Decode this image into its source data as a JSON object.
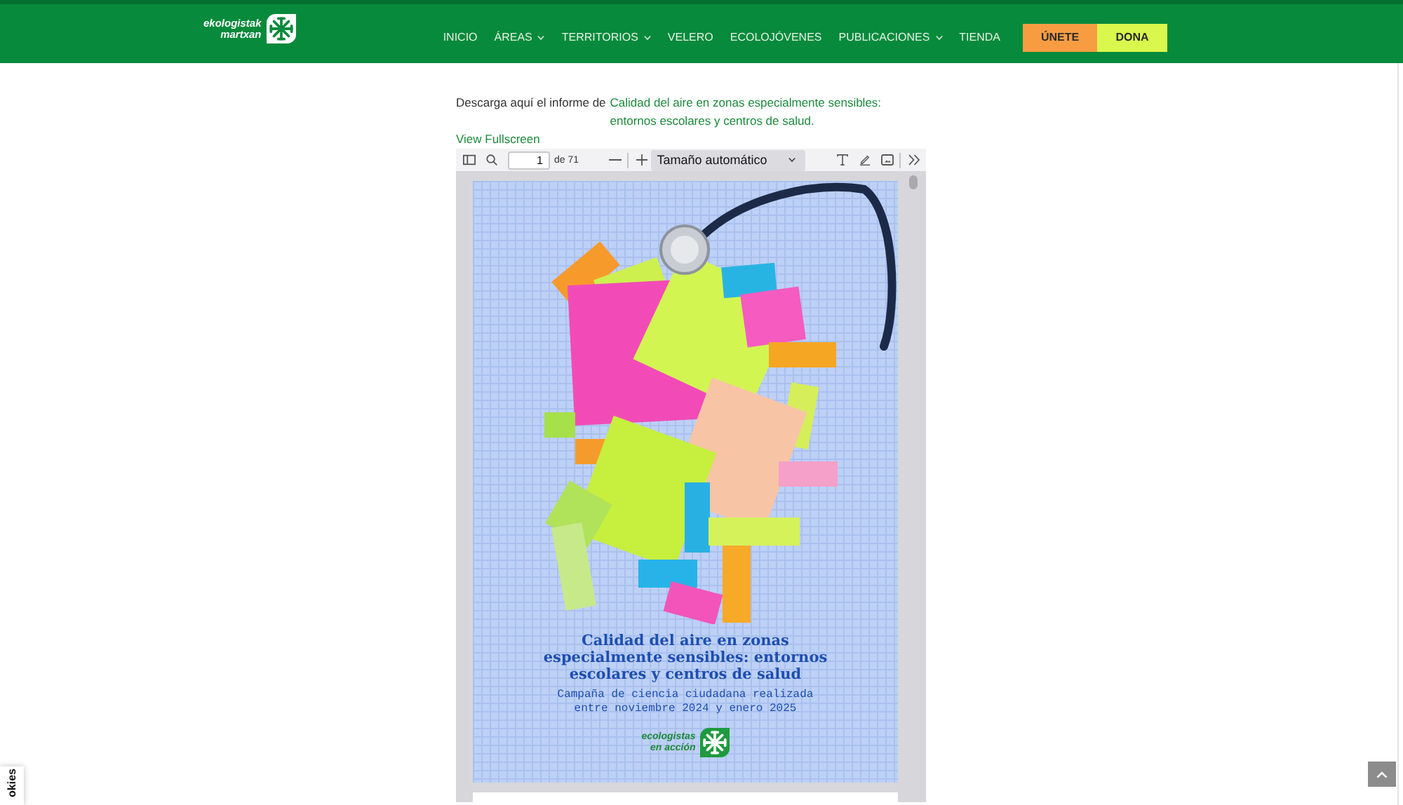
{
  "header": {
    "logo": {
      "line_1": "ekologistak",
      "line_2": "martxan"
    },
    "nav": [
      {
        "label": "INICIO",
        "dropdown": false
      },
      {
        "label": "ÁREAS",
        "dropdown": true
      },
      {
        "label": "TERRITORIOS",
        "dropdown": true
      },
      {
        "label": "VELERO",
        "dropdown": false
      },
      {
        "label": "ECOLOJÓVENES",
        "dropdown": false
      },
      {
        "label": "PUBLICACIONES",
        "dropdown": true
      },
      {
        "label": "TIENDA",
        "dropdown": false
      }
    ],
    "actions": [
      {
        "label": "ÚNETE",
        "color": "#f89c42"
      },
      {
        "label": "DONA",
        "color": "#d9f74c"
      }
    ]
  },
  "content": {
    "intro": "Descarga aquí el informe de",
    "report_link": "Calidad del aire en zonas especialmente sensibles: entornos escolares y centros de salud.",
    "fullscreen_link": "View Fullscreen"
  },
  "pdf_viewer": {
    "toolbar": {
      "page_number": "1",
      "page_count": "de 71",
      "zoom": "Tamaño automático"
    },
    "page": {
      "title_lines": [
        "Calidad del aire en zonas",
        "especialmente sensibles: entornos",
        "escolares y centros de salud"
      ],
      "subtitle_lines": [
        "Campaña de ciencia ciudadana realizada",
        "entre noviembre 2024 y enero 2025"
      ],
      "logo": {
        "line_1": "ecologistas",
        "line_2": "en acción"
      }
    }
  },
  "cookies_tab": "okies"
}
